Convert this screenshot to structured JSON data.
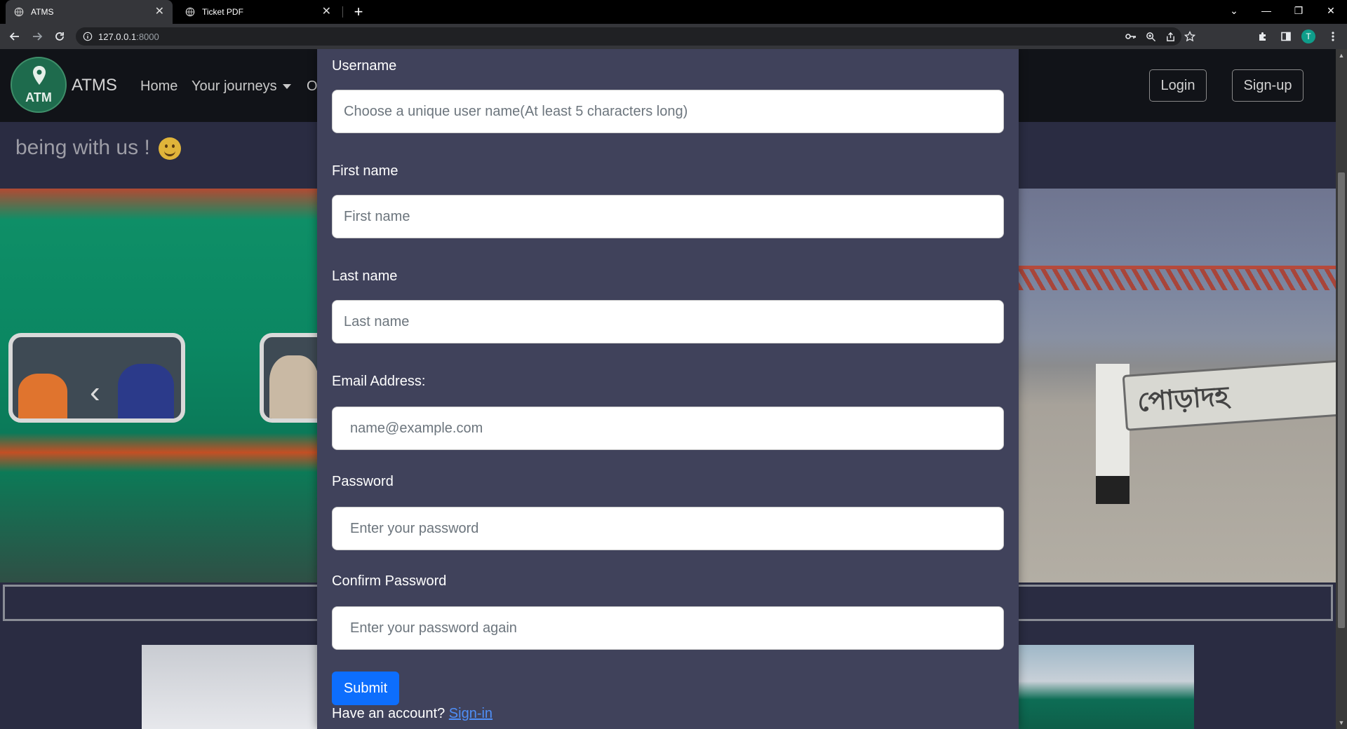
{
  "browser": {
    "tabs": [
      {
        "title": "ATMS",
        "active": true
      },
      {
        "title": "Ticket PDF",
        "active": false
      }
    ],
    "url_host": "127.0.0.1",
    "url_port": ":8000",
    "profile_initial": "T",
    "window_controls": [
      "⌄",
      "—",
      "❐",
      "✕"
    ]
  },
  "navbar": {
    "logo_text": "ATM",
    "brand": "ATMS",
    "links": [
      "Home",
      "Your journeys",
      "O"
    ],
    "login": "Login",
    "signup": "Sign-up"
  },
  "hero": {
    "tagline": "being with us !",
    "tagline_emoji": "smiling-face-icon",
    "sign_text": "পোড়াদহ"
  },
  "form": {
    "username_label": "Username",
    "username_placeholder": "Choose a unique user name(At least 5 characters long)",
    "firstname_label": "First name",
    "firstname_placeholder": "First name",
    "lastname_label": "Last name",
    "lastname_placeholder": "Last name",
    "email_label": "Email Address:",
    "email_placeholder": "name@example.com",
    "password_label": "Password",
    "password_placeholder": "Enter your password",
    "confirm_label": "Confirm Password",
    "confirm_placeholder": "Enter your password again",
    "submit": "Submit",
    "have_account": "Have an account?",
    "signin_link": "Sign-in"
  },
  "colors": {
    "accent": "#0d6efd",
    "modal_bg": "#40425b",
    "page_bg": "#2a2c42",
    "navbar_bg": "#111318"
  }
}
